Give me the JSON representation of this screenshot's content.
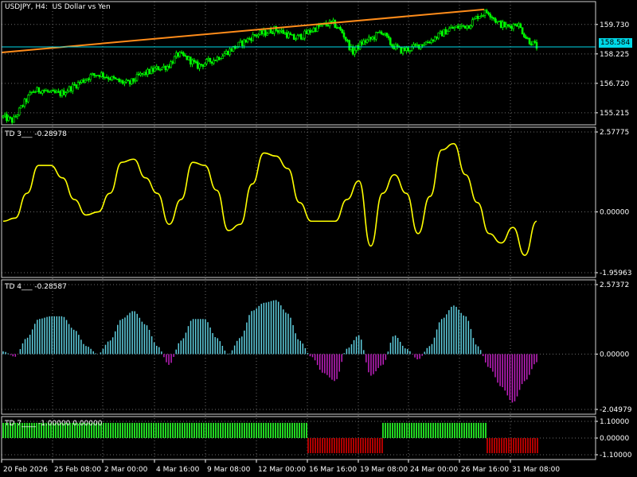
{
  "chart_header": {
    "symbol": "USDJPY",
    "timeframe": "H4",
    "description": "US Dollar vs Yen",
    "title": "USDJPY, H4:  US Dollar vs Yen"
  },
  "colors": {
    "background": "#000000",
    "grid": "#6b6b6b",
    "candle_up": "#00ff00",
    "candle_down": "#00ff00",
    "trendline": "#ff8c1a",
    "price_line": "#00d8e8",
    "td3_line": "#ffff00",
    "td4_positive": "#5fcfdf",
    "td4_negative": "#c020c0",
    "td7_positive": "#22d622",
    "td7_negative": "#b00000",
    "text": "#ffffff"
  },
  "current_price": "158.584",
  "x_axis_labels": [
    "20 Feb 2026",
    "25 Feb 08:00",
    "2 Mar 00:00",
    "4 Mar 16:00",
    "9 Mar 08:00",
    "12 Mar 00:00",
    "16 Mar 16:00",
    "19 Mar 08:00",
    "24 Mar 00:00",
    "26 Mar 16:00",
    "31 Mar 08:00"
  ],
  "panes": {
    "price": {
      "label": "USDJPY, H4:  US Dollar vs Yen",
      "y_ticks": [
        "159.730",
        "158.225",
        "156.720",
        "155.215"
      ]
    },
    "td3": {
      "label": "TD 3___ -0.28978",
      "y_ticks": [
        "2.57775",
        "0.00000",
        "-1.95963"
      ]
    },
    "td4": {
      "label": "TD 4___ -0.28587",
      "y_ticks": [
        "2.57372",
        "0.00000",
        "-2.04979"
      ]
    },
    "td7": {
      "label": "TD 7____ -1.00000 0.00000",
      "y_ticks": [
        "1.10000",
        "0.00000",
        "-1.10000"
      ]
    }
  },
  "chart_data": [
    {
      "type": "candlestick",
      "title": "USDJPY, H4:  US Dollar vs Yen",
      "ylim": [
        154.6,
        160.9
      ],
      "yticks": [
        159.73,
        158.225,
        156.72,
        155.215
      ],
      "x": [
        "20 Feb 2026",
        "25 Feb 08:00",
        "2 Mar 00:00",
        "4 Mar 16:00",
        "9 Mar 08:00",
        "12 Mar 00:00",
        "16 Mar 16:00",
        "19 Mar 08:00",
        "24 Mar 00:00",
        "26 Mar 16:00",
        "31 Mar 08:00"
      ],
      "close_path": [
        155.0,
        154.8,
        155.6,
        156.3,
        156.4,
        156.2,
        156.2,
        156.5,
        156.8,
        157.1,
        157.2,
        157.0,
        156.8,
        156.7,
        157.1,
        157.3,
        157.5,
        157.6,
        158.2,
        158.0,
        157.6,
        157.8,
        158.0,
        158.3,
        158.6,
        158.9,
        159.2,
        159.3,
        159.5,
        159.3,
        159.0,
        159.2,
        159.5,
        159.7,
        159.8,
        159.3,
        158.3,
        158.8,
        159.0,
        159.4,
        158.7,
        158.4,
        158.5,
        158.7,
        158.9,
        159.2,
        159.5,
        159.6,
        159.7,
        160.2,
        160.4,
        159.8,
        159.6,
        159.8,
        159.0,
        158.6
      ],
      "trendline": {
        "start": 158.3,
        "end": 160.5
      },
      "current_price": 158.584
    },
    {
      "type": "line",
      "title": "TD 3___ -0.28978",
      "ylim": [
        -1.95963,
        2.57775
      ],
      "series": [
        {
          "name": "TD 3",
          "values": [
            -0.3,
            -0.2,
            0.6,
            1.5,
            1.5,
            1.1,
            0.4,
            -0.1,
            0.0,
            0.6,
            1.6,
            1.7,
            1.1,
            0.6,
            -0.4,
            0.4,
            1.6,
            1.5,
            0.7,
            -0.6,
            -0.4,
            0.9,
            1.9,
            1.8,
            1.4,
            0.3,
            -0.3,
            -0.3,
            -0.3,
            0.4,
            1.0,
            -1.1,
            0.6,
            1.2,
            0.6,
            -0.7,
            0.5,
            2.0,
            2.2,
            1.2,
            0.3,
            -0.7,
            -1.0,
            -0.5,
            -1.4,
            -0.3
          ]
        }
      ],
      "last_value": -0.28978
    },
    {
      "type": "bar",
      "title": "TD 4___ -0.28587",
      "ylim": [
        -2.04979,
        2.57372
      ],
      "series": [
        {
          "name": "TD 4",
          "values": [
            0.1,
            -0.1,
            0.6,
            1.3,
            1.4,
            1.4,
            0.9,
            0.3,
            0.0,
            0.5,
            1.3,
            1.6,
            1.1,
            0.3,
            -0.4,
            0.5,
            1.3,
            1.3,
            0.6,
            0.0,
            0.6,
            1.6,
            1.9,
            2.0,
            1.5,
            0.5,
            -0.1,
            -0.7,
            -1.0,
            0.2,
            0.7,
            -0.8,
            -0.4,
            0.7,
            0.2,
            -0.2,
            0.3,
            1.3,
            1.8,
            1.4,
            0.3,
            -0.5,
            -1.2,
            -1.8,
            -1.0,
            -0.3
          ]
        }
      ],
      "last_value": -0.28587
    },
    {
      "type": "bar",
      "title": "TD 7____ -1.00000 0.00000",
      "ylim": [
        -1.1,
        1.1
      ],
      "series": [
        {
          "name": "TD 7",
          "segments": [
            {
              "from": "20 Feb 2026",
              "to": "16 Mar 16:00",
              "value": 1
            },
            {
              "from": "16 Mar 16:00",
              "to": "19 Mar 08:00",
              "value": -1
            },
            {
              "from": "19 Mar 08:00",
              "to": "26 Mar 16:00",
              "value": 1
            },
            {
              "from": "26 Mar 16:00",
              "to": "31 Mar 08:00",
              "value": -1
            }
          ]
        }
      ],
      "last_value": [
        -1.0,
        0.0
      ]
    }
  ]
}
